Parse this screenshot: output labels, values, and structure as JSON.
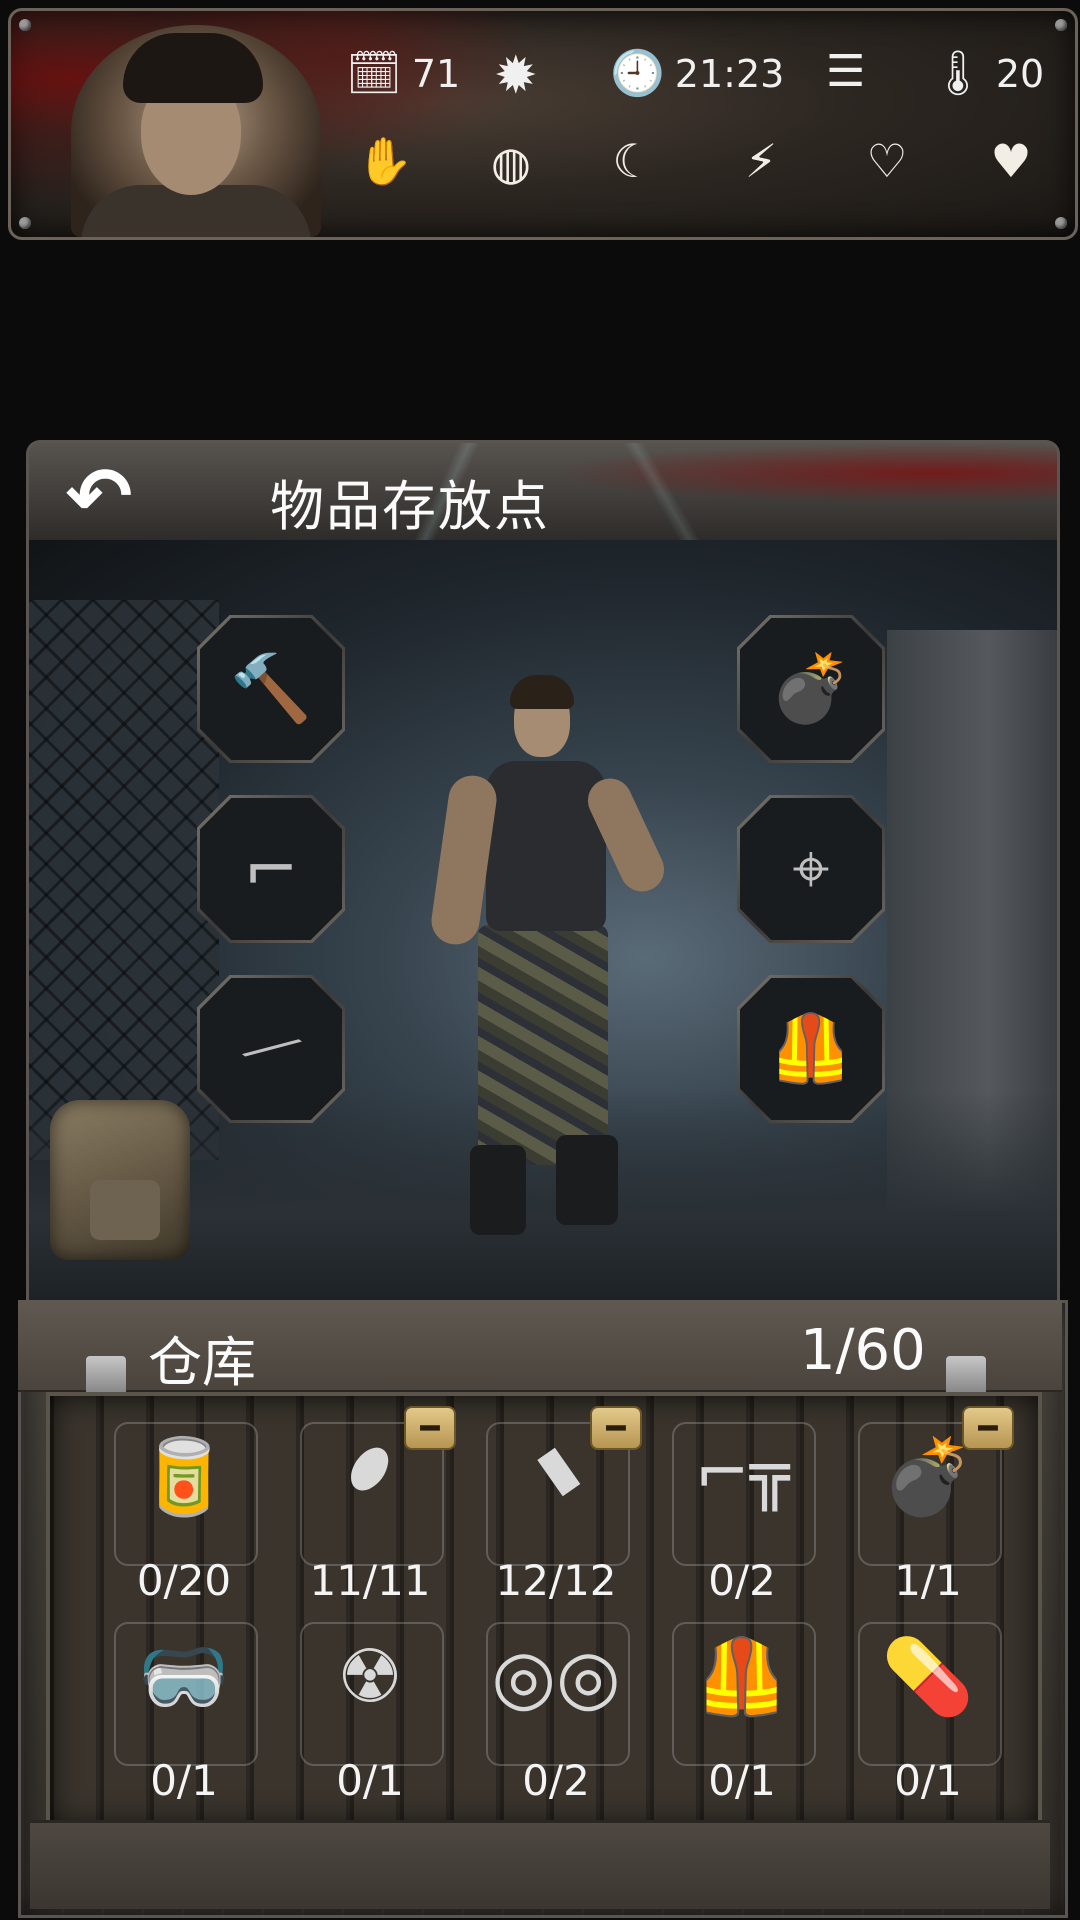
{
  "hud": {
    "day": "71",
    "time": "21:23",
    "temperature": "20",
    "icons": {
      "calendar": "calendar-icon",
      "daylight": "sun-icon",
      "clock": "clock-icon",
      "menu": "menu-icon",
      "thermometer": "thermometer-icon",
      "status": [
        "injury-hand-icon",
        "infection-icon",
        "hunger-icon",
        "fatigue-icon",
        "mood-icon",
        "health-heart-icon"
      ]
    }
  },
  "panel": {
    "title": "物品存放点",
    "equipment_left": [
      "sledgehammer-icon",
      "pistol-icon",
      "rifle-icon"
    ],
    "equipment_right": [
      "grenade-icon",
      "scope-icon",
      "body-armor-icon"
    ]
  },
  "warehouse": {
    "title": "仓库",
    "capacity": "1/60",
    "items": [
      {
        "icon": "canned-food-icon",
        "qty": "0/20",
        "removable": false
      },
      {
        "icon": "pistol-bullet-icon",
        "qty": "11/11",
        "removable": true
      },
      {
        "icon": "rifle-bullet-icon",
        "qty": "12/12",
        "removable": true
      },
      {
        "icon": "submachine-gun-icon",
        "qty": "0/2",
        "removable": false
      },
      {
        "icon": "grenade-icon",
        "qty": "1/1",
        "removable": true
      },
      {
        "icon": "goggles-icon",
        "qty": "0/1",
        "removable": false
      },
      {
        "icon": "gas-mask-icon",
        "qty": "0/1",
        "removable": false
      },
      {
        "icon": "night-vision-icon",
        "qty": "0/2",
        "removable": false
      },
      {
        "icon": "body-armor-icon",
        "qty": "0/1",
        "removable": false
      },
      {
        "icon": "pills-icon",
        "qty": "0/1",
        "removable": false
      }
    ]
  },
  "colors": {
    "accent_button": "#d3b46e",
    "text": "#f2f2f2"
  }
}
